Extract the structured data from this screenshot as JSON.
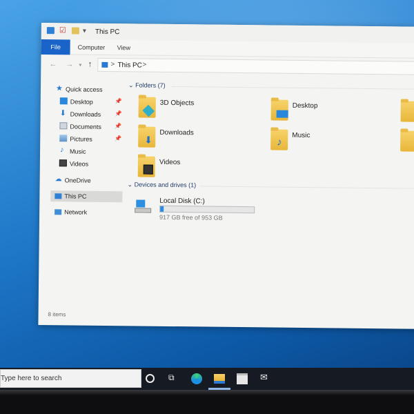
{
  "titlebar": {
    "title": "This PC",
    "quick_access_dropdown": "▾"
  },
  "ribbon": {
    "tabs": [
      "File",
      "Computer",
      "View"
    ]
  },
  "address": {
    "separator": ">",
    "location": "This PC"
  },
  "navpane": {
    "quick_access": "Quick access",
    "items": [
      {
        "label": "Desktop",
        "icon": "desktop-icon",
        "pinned": true
      },
      {
        "label": "Downloads",
        "icon": "downloads-icon",
        "pinned": true
      },
      {
        "label": "Documents",
        "icon": "documents-icon",
        "pinned": true
      },
      {
        "label": "Pictures",
        "icon": "pictures-icon",
        "pinned": true
      },
      {
        "label": "Music",
        "icon": "music-icon",
        "pinned": false
      },
      {
        "label": "Videos",
        "icon": "videos-icon",
        "pinned": false
      }
    ],
    "onedrive": "OneDrive",
    "this_pc": "This PC",
    "network": "Network"
  },
  "content": {
    "folders_header": "Folders (7)",
    "folders": [
      {
        "label": "3D Objects",
        "icon": "3d-objects-folder-icon"
      },
      {
        "label": "Desktop",
        "icon": "desktop-folder-icon"
      },
      {
        "label": "Downloads",
        "icon": "downloads-folder-icon"
      },
      {
        "label": "Music",
        "icon": "music-folder-icon"
      },
      {
        "label": "Videos",
        "icon": "videos-folder-icon"
      }
    ],
    "devices_header": "Devices and drives (1)",
    "drive": {
      "name": "Local Disk (C:)",
      "free_text": "917 GB free of 953 GB",
      "used_fraction": 0.04,
      "bar_color": "#2a8be0"
    }
  },
  "status": {
    "items_count": "8 items"
  },
  "taskbar": {
    "search_placeholder": "Type here to search",
    "icons": [
      "cortana-circle-icon",
      "task-view-icon",
      "edge-icon",
      "file-explorer-icon",
      "store-icon",
      "mail-icon"
    ]
  },
  "colors": {
    "accent": "#1a63c8",
    "desktop_blue": "#1f78c8",
    "folder_yellow": "#f0c24f"
  }
}
